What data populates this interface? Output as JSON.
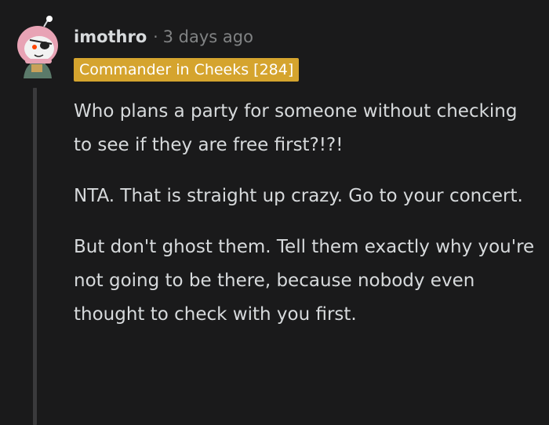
{
  "comment": {
    "avatar_icon": "snoo-avatar-icon",
    "username": "imothro",
    "separator": "·",
    "timestamp": "3 days ago",
    "flair": "Commander in Cheeks [284]",
    "flair_color": "#d5a42e",
    "paragraphs": [
      "Who plans a party for someone without checking to see if they are free first?!?!",
      "NTA. That is straight up crazy. Go to your concert.",
      "But don't ghost them. Tell them exactly why you're not going to be there, because nobody even thought to check with you first."
    ]
  }
}
